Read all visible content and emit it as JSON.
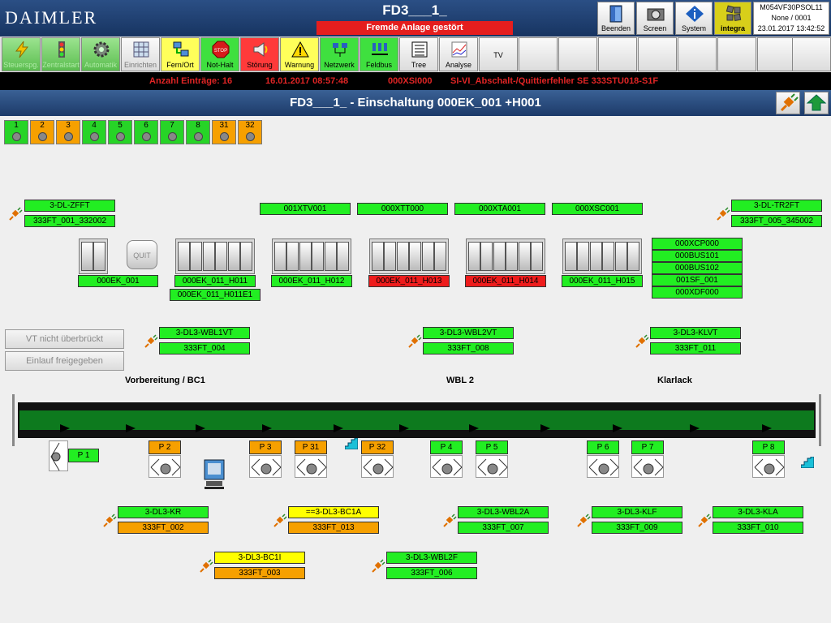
{
  "header": {
    "logo": "DAIMLER",
    "title": "FD3___1_",
    "alarm": "Fremde Anlage gestört",
    "buttons": [
      {
        "label": "Beenden",
        "icon": "exit-door-icon"
      },
      {
        "label": "Screen",
        "icon": "camera-icon"
      },
      {
        "label": "System",
        "icon": "info-icon"
      },
      {
        "label": "integra",
        "icon": "integra-grid-icon"
      }
    ],
    "info": {
      "host": "M054VF30PSOL11",
      "user": "None / 0001",
      "datetime": "23.01.2017 13:42:52"
    }
  },
  "functions": [
    {
      "label": "Steuerspg.",
      "icon": "lightning-icon",
      "state": "green"
    },
    {
      "label": "Zentralstart",
      "icon": "traffic-light-icon",
      "state": "green"
    },
    {
      "label": "Automatik",
      "icon": "gear-icon",
      "state": "green"
    },
    {
      "label": "Einrichten",
      "icon": "grid-icon",
      "state": "gray"
    },
    {
      "label": "Fern/Ort",
      "icon": "network-pc-icon",
      "state": "yellow"
    },
    {
      "label": "Not-Halt",
      "icon": "stop-sign-icon",
      "state": "green-active"
    },
    {
      "label": "Störung",
      "icon": "horn-icon",
      "state": "red"
    },
    {
      "label": "Warnung",
      "icon": "warning-triangle-icon",
      "state": "yellow"
    },
    {
      "label": "Netzwerk",
      "icon": "network-icon",
      "state": "green-active"
    },
    {
      "label": "Feldbus",
      "icon": "fieldbus-icon",
      "state": "green-active"
    },
    {
      "label": "Tree",
      "icon": "tree-list-icon",
      "state": "normal"
    },
    {
      "label": "Analyse",
      "icon": "chart-icon",
      "state": "normal"
    },
    {
      "label": "TV",
      "icon": "",
      "state": "normal"
    }
  ],
  "message": {
    "count": "Anzahl Einträge: 16",
    "datetime": "16.01.2017 08:57:48",
    "code": "000XSI000",
    "text": "SI-VI_Abschalt-/Quittierfehler SE 333STU018-S1F"
  },
  "subheader": {
    "title": "FD3___1_ - Einschaltung 000EK_001 +H001"
  },
  "stations": [
    {
      "num": "1",
      "color": "green"
    },
    {
      "num": "2",
      "color": "orange"
    },
    {
      "num": "3",
      "color": "orange"
    },
    {
      "num": "4",
      "color": "green"
    },
    {
      "num": "5",
      "color": "green"
    },
    {
      "num": "6",
      "color": "green"
    },
    {
      "num": "7",
      "color": "green"
    },
    {
      "num": "8",
      "color": "green"
    },
    {
      "num": "31",
      "color": "orange"
    },
    {
      "num": "32",
      "color": "orange"
    }
  ],
  "top_labels": {
    "zfft": "3-DL-ZFFT",
    "zfft_ft": "333FT_001_332002",
    "tr2ft": "3-DL-TR2FT",
    "tr2ft_ft": "333FT_005_345002",
    "xtv": "001XTV001",
    "xtt": "000XTT000",
    "xta": "000XTA001",
    "xsc": "000XSC001"
  },
  "cabinets": {
    "ek001": "000EK_001",
    "quit": "QUIT",
    "h011": "000EK_011_H011",
    "h011e1": "000EK_011_H011E1",
    "h012": "000EK_011_H012",
    "h013": "000EK_011_H013",
    "h014": "000EK_011_H014",
    "h015": "000EK_011_H015"
  },
  "stack": [
    "000XCP000",
    "000BUS101",
    "000BUS102",
    "001SF_001",
    "000XDF000"
  ],
  "status_buttons": {
    "vt": "VT nicht überbrückt",
    "einlauf": "Einlauf freigegeben"
  },
  "mid_labels": {
    "wbl1vt": "3-DL3-WBL1VT",
    "wbl1vt_ft": "333FT_004",
    "wbl2vt": "3-DL3-WBL2VT",
    "wbl2vt_ft": "333FT_008",
    "klvt": "3-DL3-KLVT",
    "klvt_ft": "333FT_011"
  },
  "sections": {
    "s1": "Vorbereitung / BC1",
    "s2": "WBL 2",
    "s3": "Klarlack"
  },
  "positions": [
    "P 1",
    "P 2",
    "P 3",
    "P 31",
    "P 32",
    "P 4",
    "P 5",
    "P 6",
    "P 7",
    "P 8"
  ],
  "bottom_labels": {
    "kr": "3-DL3-KR",
    "kr_ft": "333FT_002",
    "bc1a": "==3-DL3-BC1A",
    "bc1a_ft": "333FT_013",
    "wbl2a": "3-DL3-WBL2A",
    "wbl2a_ft": "333FT_007",
    "klf": "3-DL3-KLF",
    "klf_ft": "333FT_009",
    "kla": "3-DL3-KLA",
    "kla_ft": "333FT_010",
    "bc1i": "3-DL3-BC1I",
    "bc1i_ft": "333FT_003",
    "wbl2f": "3-DL3-WBL2F",
    "wbl2f_ft": "333FT_006"
  }
}
